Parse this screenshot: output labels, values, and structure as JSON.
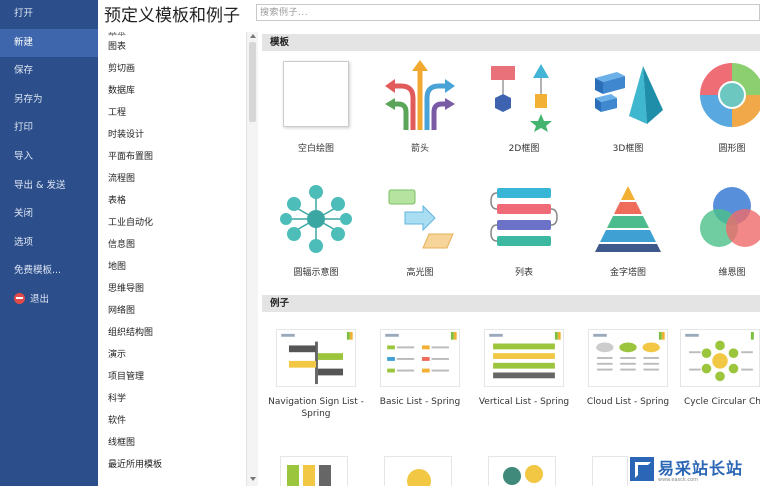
{
  "nav": {
    "items": [
      {
        "label": "打开"
      },
      {
        "label": "新建"
      },
      {
        "label": "保存"
      },
      {
        "label": "另存为"
      },
      {
        "label": "打印"
      },
      {
        "label": "导入"
      },
      {
        "label": "导出 & 发送"
      },
      {
        "label": "关闭"
      },
      {
        "label": "选项"
      },
      {
        "label": "免费模板..."
      },
      {
        "label": "退出"
      }
    ],
    "active_index": 1,
    "background": "#2c4e8a",
    "active_background": "#3d66ac"
  },
  "header": {
    "title": "预定义模板和例子",
    "search_placeholder": "搜索例子..."
  },
  "categories": {
    "partial_top": "基本",
    "items": [
      "图表",
      "剪切画",
      "数据库",
      "工程",
      "时装设计",
      "平面布置图",
      "流程图",
      "表格",
      "工业自动化",
      "信息图",
      "地图",
      "思维导图",
      "网络图",
      "组织结构图",
      "演示",
      "项目管理",
      "科学",
      "软件",
      "线框图",
      "最近所用模板"
    ]
  },
  "templates": {
    "header": "模板",
    "items": [
      {
        "label": "空白绘图",
        "icon": "blank-page-icon"
      },
      {
        "label": "箭头",
        "icon": "arrows-icon"
      },
      {
        "label": "2D框图",
        "icon": "2d-block-icon"
      },
      {
        "label": "3D框图",
        "icon": "3d-block-icon"
      },
      {
        "label": "圆形图",
        "icon": "circular-diagram-icon"
      },
      {
        "label": "圆辐示意图",
        "icon": "radial-diagram-icon"
      },
      {
        "label": "高光图",
        "icon": "highlight-diagram-icon"
      },
      {
        "label": "列表",
        "icon": "list-icon"
      },
      {
        "label": "金字塔图",
        "icon": "pyramid-icon"
      },
      {
        "label": "维恩图",
        "icon": "venn-diagram-icon"
      }
    ]
  },
  "examples": {
    "header": "例子",
    "items": [
      {
        "label": "Navigation Sign List - Spring"
      },
      {
        "label": "Basic List - Spring"
      },
      {
        "label": "Vertical List - Spring"
      },
      {
        "label": "Cloud List - Spring"
      },
      {
        "label": "Cycle Circular Chart - Spring"
      }
    ]
  },
  "watermark": {
    "text": "易采站长站",
    "sub": "www.easck.com"
  }
}
